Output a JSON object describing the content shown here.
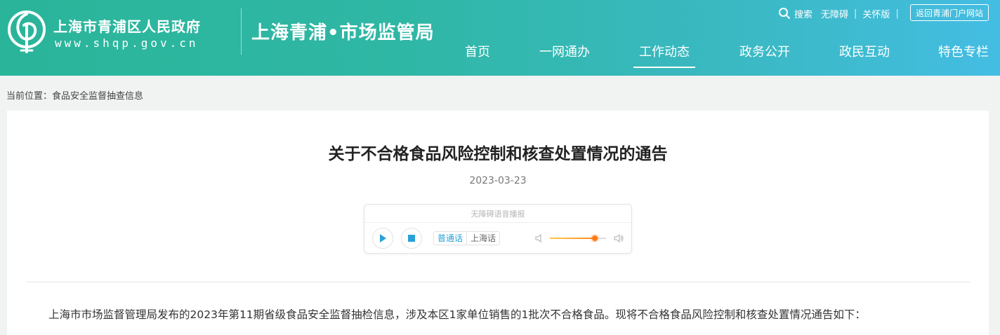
{
  "header": {
    "gov_name": "上海市青浦区人民政府",
    "gov_url": "www.shqp.gov.cn",
    "bureau": "上海青浦•市场监管局",
    "util": {
      "search": "搜索",
      "accessible": "无障碍",
      "divider": "|",
      "elderly": "关怀版",
      "portal": "返回青浦门户网站"
    },
    "nav": [
      {
        "label": "首页"
      },
      {
        "label": "一网通办"
      },
      {
        "label": "工作动态",
        "active": true
      },
      {
        "label": "政务公开"
      },
      {
        "label": "政民互动"
      },
      {
        "label": "特色专栏"
      }
    ]
  },
  "breadcrumb": "当前位置：食品安全监督抽查信息",
  "article": {
    "title": "关于不合格食品风险控制和核查处置情况的通告",
    "date": "2023-03-23",
    "player": {
      "label": "无障碍语音播报",
      "lang_mandarin": "普通话",
      "lang_shanghai": "上海话",
      "volume": 0.8
    },
    "paragraph": "上海市市场监督管理局发布的2023年第11期省级食品安全监督抽检信息，涉及本区1家单位销售的1批次不合格食品。现将不合格食品风险控制和核查处置情况通告如下："
  },
  "colors": {
    "header_start": "#2ab59a",
    "header_end": "#44bde3",
    "accent": "#2aa1d8",
    "volume": "#ff7a1a"
  }
}
